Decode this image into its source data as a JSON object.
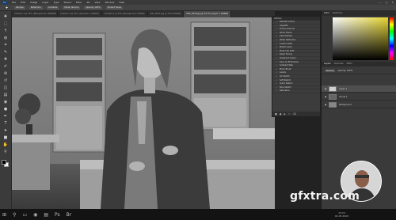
{
  "app": {
    "name": "Photoshop",
    "logo": "Ps"
  },
  "menu": [
    "File",
    "Edit",
    "Image",
    "Layer",
    "Type",
    "Select",
    "Filter",
    "3D",
    "View",
    "Window",
    "Help"
  ],
  "options": {
    "chips": [
      "Sample",
      "Reflection",
      "Contents",
      "Mode: Normal",
      "Opacity 100%",
      "Protect Tones"
    ]
  },
  "tabs": [
    {
      "label": "Untitled-1 @ 25% (Background, RGB/8#)",
      "active": false
    },
    {
      "label": "Untitled-2 @ 25% (Channel 1, RGB/8)",
      "active": false
    },
    {
      "label": "Untitled-3 @ 25% (Background, RGB/8)",
      "active": false
    },
    {
      "label": "IMG_0001.jpg @ 25% (RGB/8)",
      "active": false
    },
    {
      "label": "DSC_3524.jpg @ 33.3% (Layer 1, RGB/8)",
      "active": true
    }
  ],
  "toolbar": {
    "tools": [
      "move-icon",
      "marquee-icon",
      "lasso-icon",
      "quick-select-icon",
      "crop-icon",
      "eyedropper-icon",
      "healing-icon",
      "brush-icon",
      "stamp-icon",
      "history-brush-icon",
      "eraser-icon",
      "gradient-icon",
      "blur-icon",
      "dodge-icon",
      "pen-icon",
      "type-icon",
      "path-select-icon",
      "shape-icon",
      "hand-icon",
      "zoom-icon"
    ],
    "glyphs": [
      "✥",
      "⬚",
      "ϟ",
      "◍",
      "⌗",
      "✎",
      "✚",
      "✐",
      "⊛",
      "↺",
      "◫",
      "▤",
      "◉",
      "●",
      "✒",
      "T",
      "➤",
      "■",
      "✋",
      "⚲"
    ]
  },
  "float_panel": {
    "title": "Actions",
    "rows": [
      "Default Actions",
      "Vignette",
      "Frame Channel",
      "Wood Frame",
      "Cast Shadow",
      "Water Reflection",
      "Custom RGB",
      "Molten Lead",
      "Make Clip Path",
      "Sepia Toning",
      "Quadrant Colors",
      "Save As Photoshop",
      "Gradient Map",
      "Mixer Brush",
      "Levels",
      "Ink Sketch",
      "Soft Sketch",
      "Quick Sketch",
      "Nice Sketch",
      "Saturation"
    ]
  },
  "dock": {
    "color_tabs": [
      "Color",
      "Swatches"
    ],
    "layer_tabs": [
      "Layers",
      "Channels",
      "Paths"
    ],
    "layers": [
      {
        "name": "Layer 1",
        "selected": true
      },
      {
        "name": "Group 1",
        "selected": false
      },
      {
        "name": "Background",
        "selected": false
      }
    ],
    "blend_mode": "Normal",
    "opacity": "Opacity: 100%"
  },
  "taskbar": {
    "icons": [
      "windows-icon",
      "search-icon",
      "task-view-icon",
      "browser-icon",
      "folder-icon",
      "photoshop-icon",
      "bridge-icon"
    ],
    "glyphs": [
      "⊞",
      "⚲",
      "▭",
      "◉",
      "▤",
      "Ps",
      "Br"
    ],
    "time": "13:24",
    "date": "04.03.2020"
  },
  "watermark": "gfxtra.com",
  "colors": {
    "accent": "#4aa3ff",
    "panel": "#3a3a3a",
    "dark": "#222222"
  }
}
